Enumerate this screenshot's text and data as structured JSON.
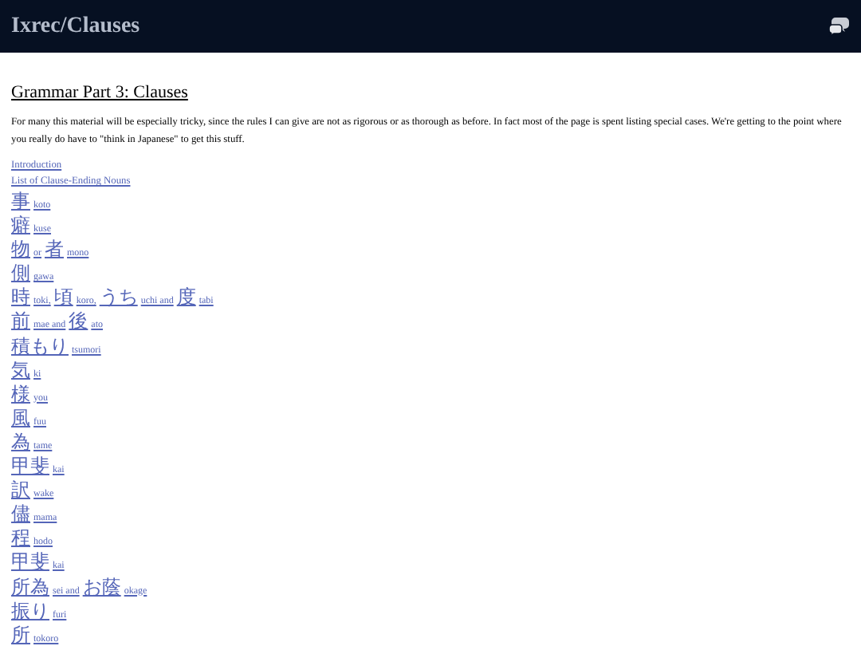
{
  "header": {
    "title": "Ixrec/Clauses"
  },
  "heading": "Grammar Part 3: Clauses",
  "intro": "For many this material will be especially tricky, since the rules I can give are not as rigorous or as thorough as before. In fact most of the page is spent listing special cases. We're getting to the point where you really do have to \"think in Japanese\" to get this stuff.",
  "nav_links": [
    "Introduction",
    "List of Clause-Ending Nouns"
  ],
  "noun_links": [
    [
      {
        "kind": "kanji",
        "text": "事"
      },
      {
        "kind": "romaji",
        "text": "koto"
      }
    ],
    [
      {
        "kind": "kanji",
        "text": "癖"
      },
      {
        "kind": "romaji",
        "text": "kuse"
      }
    ],
    [
      {
        "kind": "kanji",
        "text": "物"
      },
      {
        "kind": "romaji",
        "text": "or"
      },
      {
        "kind": "kanji",
        "text": "者"
      },
      {
        "kind": "romaji",
        "text": "mono"
      }
    ],
    [
      {
        "kind": "kanji",
        "text": "側"
      },
      {
        "kind": "romaji",
        "text": "gawa"
      }
    ],
    [
      {
        "kind": "kanji",
        "text": "時"
      },
      {
        "kind": "romaji",
        "text": "toki,"
      },
      {
        "kind": "kanji",
        "text": "頃"
      },
      {
        "kind": "romaji",
        "text": "koro,"
      },
      {
        "kind": "kanji",
        "text": "うち"
      },
      {
        "kind": "romaji",
        "text": "uchi and"
      },
      {
        "kind": "kanji",
        "text": "度"
      },
      {
        "kind": "romaji",
        "text": "tabi"
      }
    ],
    [
      {
        "kind": "kanji",
        "text": "前"
      },
      {
        "kind": "romaji",
        "text": "mae and"
      },
      {
        "kind": "kanji",
        "text": "後"
      },
      {
        "kind": "romaji",
        "text": "ato"
      }
    ],
    [
      {
        "kind": "kanji",
        "text": "積もり"
      },
      {
        "kind": "romaji",
        "text": "tsumori"
      }
    ],
    [
      {
        "kind": "kanji",
        "text": "気"
      },
      {
        "kind": "romaji",
        "text": "ki"
      }
    ],
    [
      {
        "kind": "kanji",
        "text": "様"
      },
      {
        "kind": "romaji",
        "text": "you"
      }
    ],
    [
      {
        "kind": "kanji",
        "text": "風"
      },
      {
        "kind": "romaji",
        "text": "fuu"
      }
    ],
    [
      {
        "kind": "kanji",
        "text": "為"
      },
      {
        "kind": "romaji",
        "text": "tame"
      }
    ],
    [
      {
        "kind": "kanji",
        "text": "甲斐"
      },
      {
        "kind": "romaji",
        "text": "kai"
      }
    ],
    [
      {
        "kind": "kanji",
        "text": "訳"
      },
      {
        "kind": "romaji",
        "text": "wake"
      }
    ],
    [
      {
        "kind": "kanji",
        "text": "儘"
      },
      {
        "kind": "romaji",
        "text": "mama"
      }
    ],
    [
      {
        "kind": "kanji",
        "text": "程"
      },
      {
        "kind": "romaji",
        "text": "hodo"
      }
    ],
    [
      {
        "kind": "kanji",
        "text": "甲斐"
      },
      {
        "kind": "romaji",
        "text": "kai"
      }
    ],
    [
      {
        "kind": "kanji",
        "text": "所為"
      },
      {
        "kind": "romaji",
        "text": "sei and"
      },
      {
        "kind": "kanji",
        "text": "お蔭"
      },
      {
        "kind": "romaji",
        "text": "okage"
      }
    ],
    [
      {
        "kind": "kanji",
        "text": "振り"
      },
      {
        "kind": "romaji",
        "text": "furi"
      }
    ],
    [
      {
        "kind": "kanji",
        "text": "所"
      },
      {
        "kind": "romaji",
        "text": "tokoro"
      }
    ]
  ]
}
